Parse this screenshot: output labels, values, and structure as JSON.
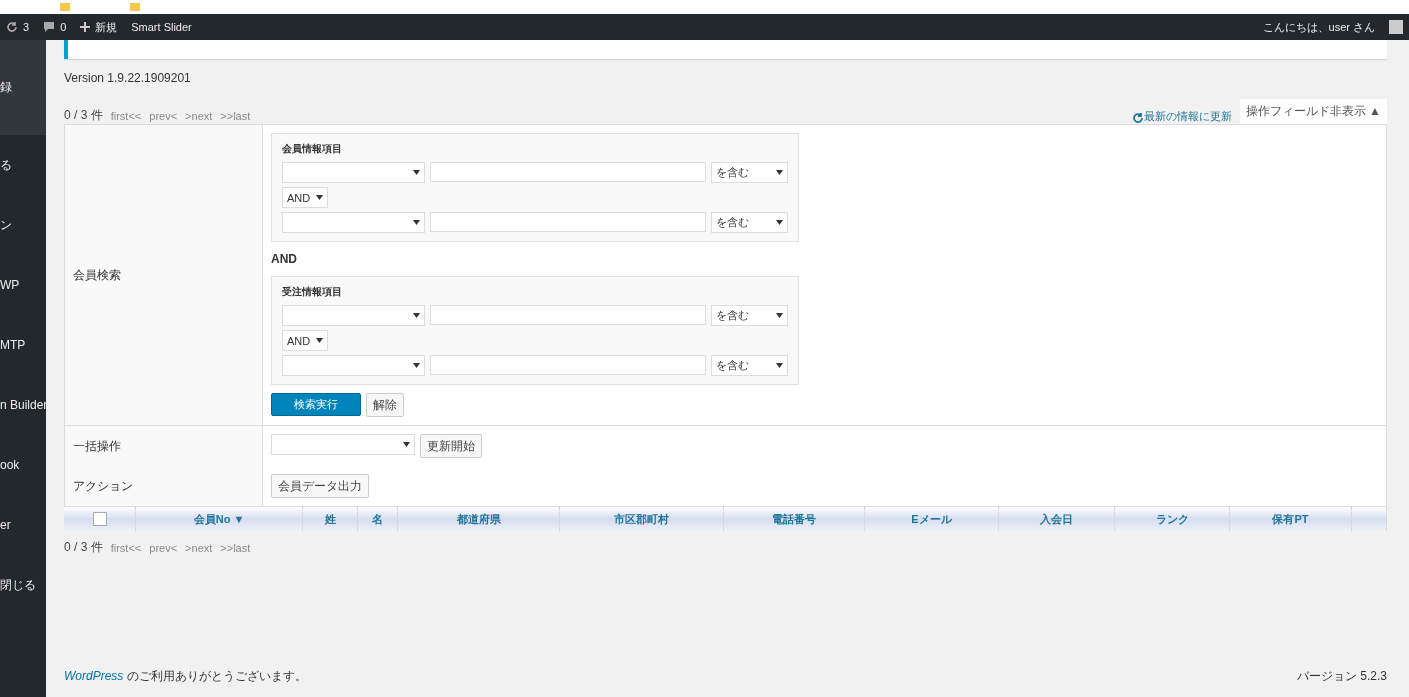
{
  "admin_bar": {
    "updates": "3",
    "comments": "0",
    "new": "新規",
    "plugin": "Smart Slider",
    "greeting": "こんにちは、user さん"
  },
  "sidebar": {
    "items": [
      {
        "label": "録",
        "selected": true
      },
      {
        "label": "る",
        "selected": false
      },
      {
        "label": "ン",
        "selected": false
      },
      {
        "label": "WP",
        "selected": false
      },
      {
        "label": "MTP",
        "selected": false
      },
      {
        "label": "n Builder",
        "selected": false
      },
      {
        "label": "ook",
        "selected": false
      },
      {
        "label": "er",
        "selected": false
      },
      {
        "label": "閉じる",
        "selected": false
      }
    ]
  },
  "version": "Version 1.9.22.1909201",
  "pager_top": {
    "count": "0 / 3 件",
    "links": [
      "first<<",
      "prev<",
      ">next",
      ">>last"
    ]
  },
  "refresh_link": "最新の情報に更新",
  "toggle_tab": "操作フィールド非表示 ▲",
  "search": {
    "label": "会員検索",
    "groups": [
      {
        "title": "会員情報項目",
        "rows": [
          {
            "condition": "を含む"
          },
          {
            "condition": "を含む"
          }
        ],
        "join": "AND"
      },
      {
        "title": "受注情報項目",
        "rows": [
          {
            "condition": "を含む"
          },
          {
            "condition": "を含む"
          }
        ],
        "join": "AND"
      }
    ],
    "between": "AND",
    "submit": "検索実行",
    "reset": "解除"
  },
  "bulk": {
    "label": "一括操作",
    "button": "更新開始"
  },
  "action": {
    "label": "アクション",
    "button": "会員データ出力"
  },
  "table": {
    "columns": [
      {
        "kind": "checkbox",
        "checked": false
      },
      {
        "kind": "text",
        "label": "会員No ▼"
      },
      {
        "kind": "text",
        "label": "姓"
      },
      {
        "kind": "text",
        "label": "名"
      },
      {
        "kind": "text",
        "label": "都道府県"
      },
      {
        "kind": "text",
        "label": "市区郡町村"
      },
      {
        "kind": "text",
        "label": "電話番号"
      },
      {
        "kind": "text",
        "label": "Eメール"
      },
      {
        "kind": "text",
        "label": "入会日"
      },
      {
        "kind": "text",
        "label": "ランク"
      },
      {
        "kind": "text",
        "label": "保有PT"
      },
      {
        "kind": "empty"
      }
    ]
  },
  "pager_bottom": {
    "count": "0 / 3 件",
    "links": [
      "first<<",
      "prev<",
      ">next",
      ">>last"
    ]
  },
  "footer": {
    "link": "WordPress",
    "thanks": "のご利用ありがとうございます。",
    "version": "バージョン 5.2.3"
  }
}
